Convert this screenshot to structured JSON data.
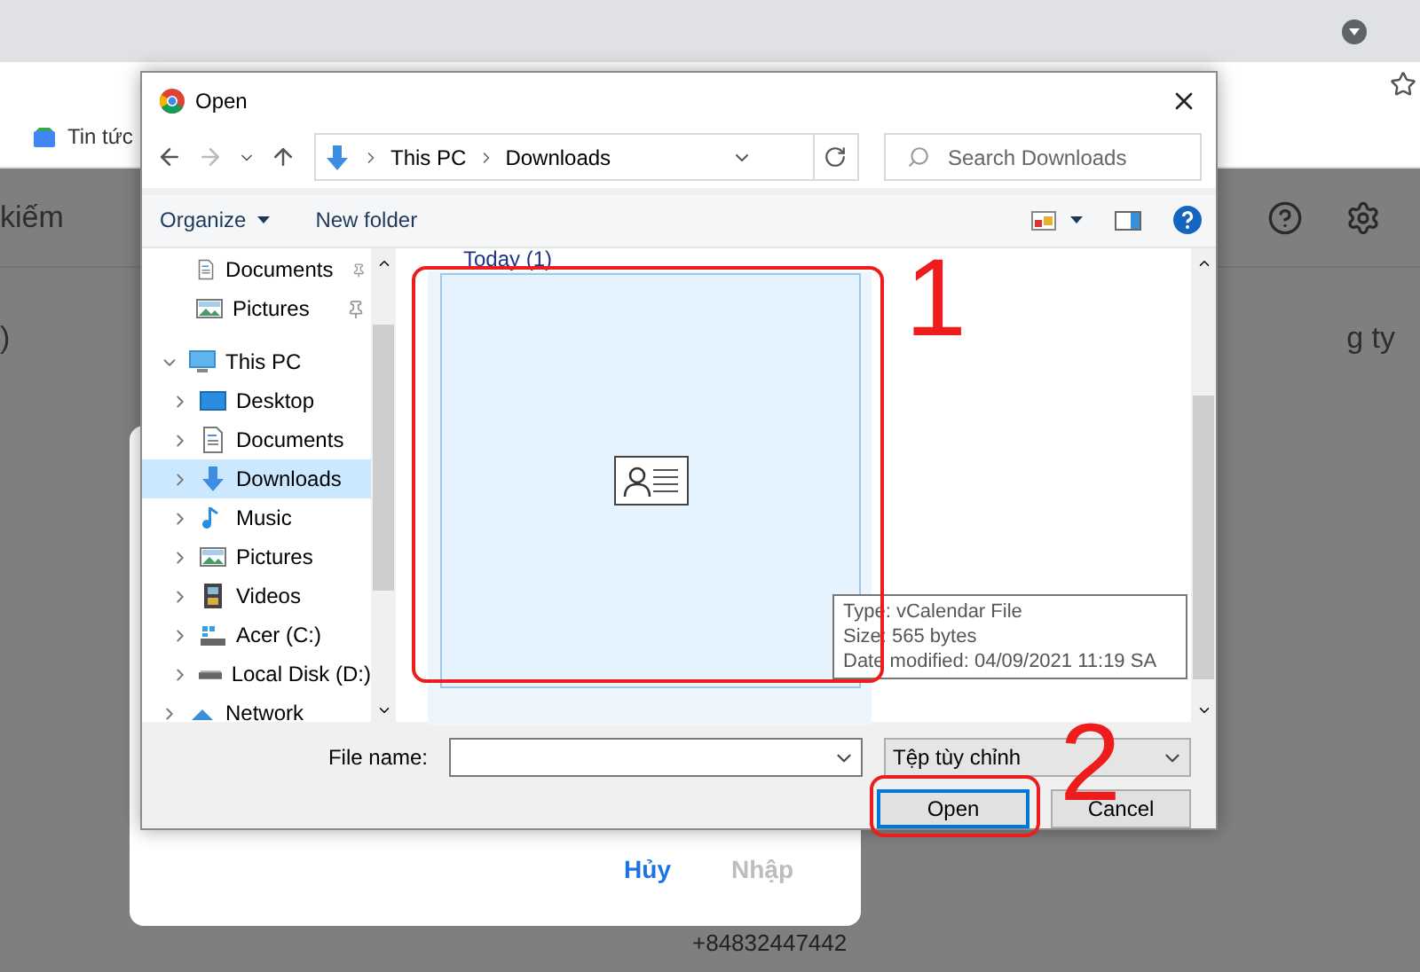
{
  "browser": {
    "bookmark": "Tin tức"
  },
  "page": {
    "search_text": "kiếm",
    "column_text": "g ty",
    "row_text": ")",
    "phone": "+84832447442"
  },
  "import_modal": {
    "buttons": [
      {
        "label": "Hủy",
        "disabled": false
      },
      {
        "label": "Nhập",
        "disabled": true
      }
    ]
  },
  "dialog": {
    "title": "Open",
    "breadcrumb": [
      "This PC",
      "Downloads"
    ],
    "search": {
      "placeholder": "Search Downloads"
    },
    "toolbar": [
      {
        "label": "Organize",
        "kind": "menu"
      },
      {
        "label": "New folder",
        "kind": "button"
      }
    ],
    "quick_access": [
      {
        "label": "Documents",
        "kind": "documents",
        "pinned": true,
        "selected": false
      },
      {
        "label": "Pictures",
        "kind": "pictures",
        "pinned": true,
        "selected": false
      }
    ],
    "tree": [
      {
        "label": "This PC",
        "kind": "pc",
        "expanded": true,
        "selected": false,
        "children": [
          {
            "label": "Desktop",
            "kind": "desktop",
            "expanded": false,
            "selected": false
          },
          {
            "label": "Documents",
            "kind": "documents",
            "expanded": false,
            "selected": false
          },
          {
            "label": "Downloads",
            "kind": "downloads",
            "expanded": false,
            "selected": true
          },
          {
            "label": "Music",
            "kind": "music",
            "expanded": false,
            "selected": false
          },
          {
            "label": "Pictures",
            "kind": "pictures",
            "expanded": false,
            "selected": false
          },
          {
            "label": "Videos",
            "kind": "videos",
            "expanded": false,
            "selected": false
          },
          {
            "label": "Acer (C:)",
            "kind": "system-drive",
            "expanded": false,
            "selected": false
          },
          {
            "label": "Local Disk (D:)",
            "kind": "drive",
            "expanded": false,
            "selected": false
          }
        ]
      },
      {
        "label": "Network",
        "kind": "network",
        "expanded": false,
        "selected": false
      }
    ],
    "group_header": "Today (1)",
    "file": {
      "selected": true
    },
    "tooltip": [
      "Type: vCalendar File",
      "Size: 565 bytes",
      "Date modified: 04/09/2021 11:19 SA"
    ],
    "file_name_label": "File name:",
    "filter": "Tệp tùy chỉnh",
    "buttons": [
      {
        "label": "Open",
        "default": true
      },
      {
        "label": "Cancel",
        "default": false
      }
    ]
  },
  "annotations": [
    {
      "label": "1"
    },
    {
      "label": "2"
    }
  ]
}
